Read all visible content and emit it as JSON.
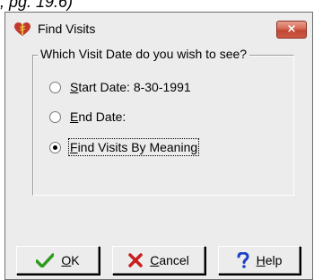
{
  "page_fragment": ", pg. 19.6)",
  "window": {
    "title": "Find Visits",
    "close_label": "×"
  },
  "group": {
    "label": "Which Visit Date do you wish to see?"
  },
  "options": [
    {
      "mnemonic": "S",
      "rest": "tart Date: 8-30-1991",
      "checked": false
    },
    {
      "mnemonic": "E",
      "rest": "nd Date:",
      "checked": false
    },
    {
      "mnemonic": "F",
      "rest": "ind Visits By Meaning",
      "checked": true
    }
  ],
  "buttons": {
    "ok": {
      "mnemonic": "O",
      "rest": "K"
    },
    "cancel": {
      "mnemonic": "C",
      "rest": "ancel"
    },
    "help": {
      "mnemonic": "H",
      "rest": "elp"
    }
  },
  "colors": {
    "dialog_bg": "#ececec",
    "close_red": "#c0452f",
    "ok_green": "#2e9a1e",
    "cancel_red": "#c81e1e",
    "help_blue": "#1a3fc8"
  },
  "icons": {
    "app": "heart-caduceus-icon",
    "ok": "checkmark-icon",
    "cancel": "x-icon",
    "help": "question-mark-icon"
  }
}
